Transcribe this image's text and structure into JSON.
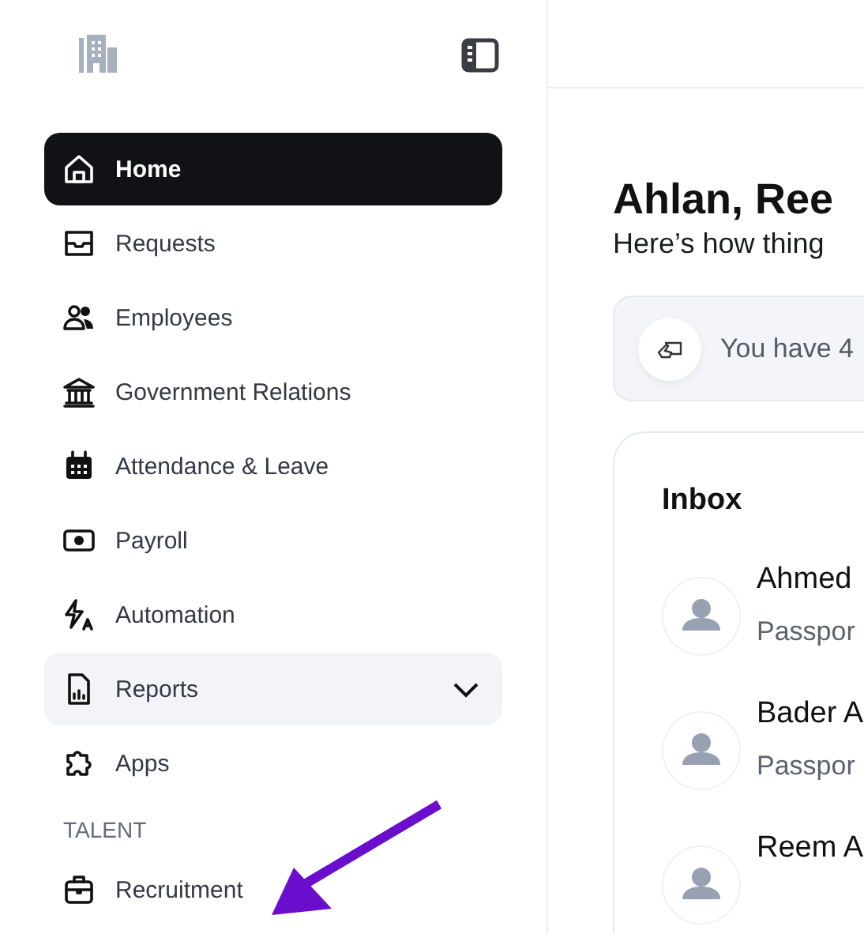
{
  "sidebar": {
    "sections": [
      {
        "items": [
          {
            "label": "Home",
            "selected": true,
            "kind": "link"
          },
          {
            "label": "Requests",
            "selected": false,
            "kind": "link"
          },
          {
            "label": "Employees",
            "selected": false,
            "kind": "link"
          },
          {
            "label": "Government Relations",
            "selected": false,
            "kind": "link"
          },
          {
            "label": "Attendance & Leave",
            "selected": false,
            "kind": "link"
          },
          {
            "label": "Payroll",
            "selected": false,
            "kind": "link"
          },
          {
            "label": "Automation",
            "selected": false,
            "kind": "link"
          },
          {
            "label": "Reports",
            "selected": false,
            "kind": "group",
            "expanded": false,
            "highlighted": true
          },
          {
            "label": "Apps",
            "selected": false,
            "kind": "link"
          }
        ]
      },
      {
        "title": "TALENT",
        "items": [
          {
            "label": "Recruitment",
            "selected": false,
            "kind": "link"
          }
        ]
      }
    ]
  },
  "main": {
    "greeting": "Ahlan, Ree",
    "subtitle": "Here’s how thing",
    "notice": "You have 4",
    "inbox": {
      "title": "Inbox",
      "messages": [
        {
          "name": "Ahmed",
          "detail": "Passpor"
        },
        {
          "name": "Bader A",
          "detail": "Passpor"
        },
        {
          "name": "Reem A"
        }
      ]
    }
  }
}
